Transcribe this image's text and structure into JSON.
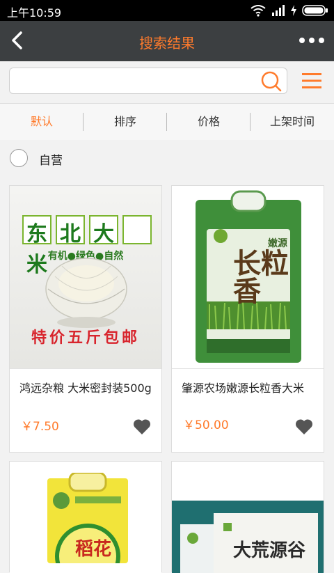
{
  "status": {
    "time": "上午10:59"
  },
  "header": {
    "title": "搜索结果"
  },
  "search": {
    "value": "",
    "placeholder": ""
  },
  "filters": {
    "tabs": [
      "默认",
      "排序",
      "价格",
      "上架时间"
    ],
    "active": 0
  },
  "self_operated": {
    "label": "自营"
  },
  "products": [
    {
      "name": "鸿远杂粮 大米密封装500g",
      "price": "￥7.50",
      "img_title": "东北大米",
      "img_sub": "有机●绿色●自然",
      "img_banner": "特价五斤包邮"
    },
    {
      "name": "肇源农场嫩源长粒香大米",
      "price": "￥50.00",
      "img_title": "长粒香",
      "img_brand": "嫩源"
    },
    {
      "name": "",
      "price": "",
      "img_text": "稻花"
    },
    {
      "name": "",
      "price": "",
      "img_text": "大荒源谷"
    }
  ],
  "colors": {
    "accent": "#ff7b2c",
    "appbar": "#3c3f41"
  }
}
